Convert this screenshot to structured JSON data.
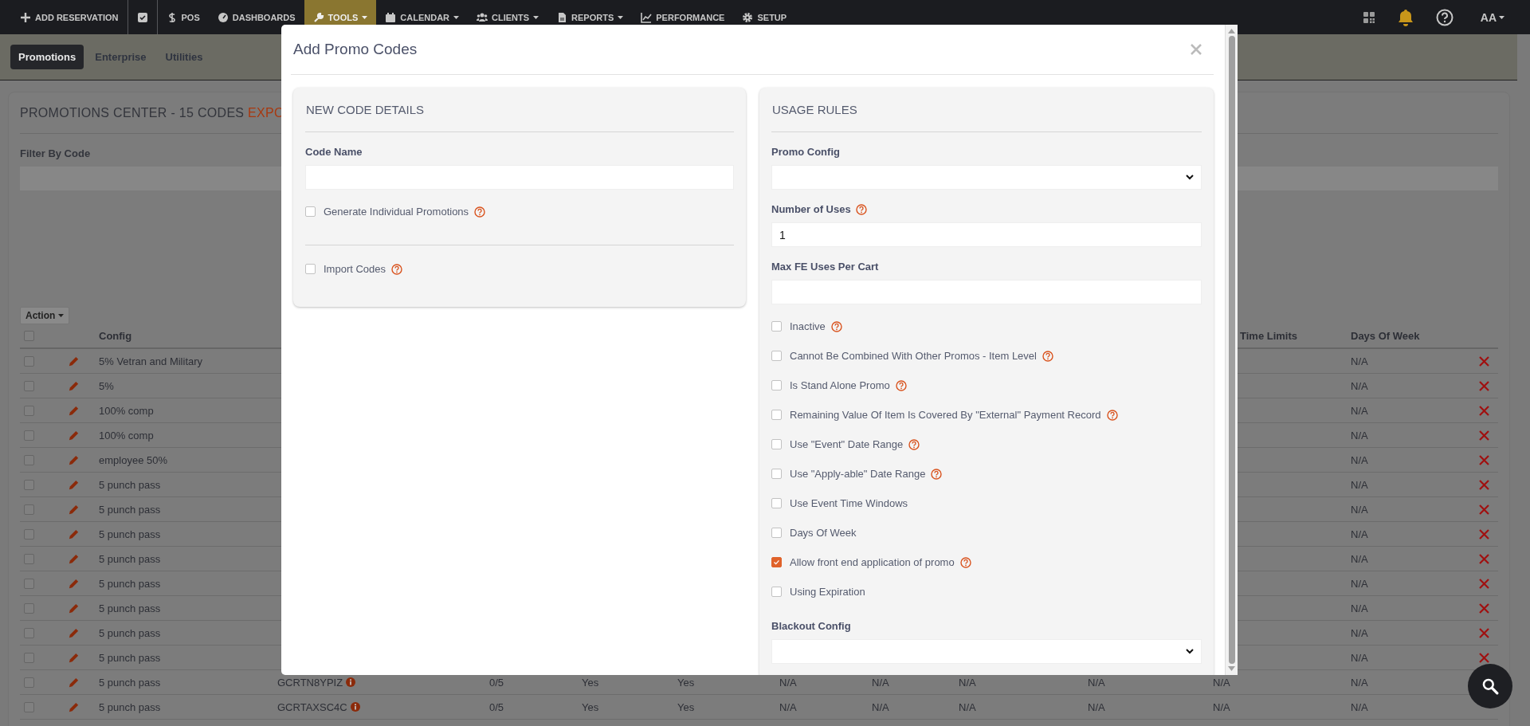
{
  "nav": {
    "items": [
      {
        "label": "ADD RESERVATION",
        "selected": false,
        "dropdown": false
      },
      {
        "selected": false,
        "dropdown": false
      },
      {
        "label": "POS",
        "selected": false,
        "dropdown": false
      },
      {
        "label": "DASHBOARDS",
        "selected": false,
        "dropdown": false
      },
      {
        "label": "TOOLS",
        "selected": true,
        "dropdown": true
      },
      {
        "label": "CALENDAR",
        "selected": false,
        "dropdown": true
      },
      {
        "label": "CLIENTS",
        "selected": false,
        "dropdown": true
      },
      {
        "label": "REPORTS",
        "selected": false,
        "dropdown": true
      },
      {
        "label": "PERFORMANCE",
        "selected": false,
        "dropdown": false
      },
      {
        "label": "SETUP",
        "selected": false,
        "dropdown": false
      }
    ],
    "account": "AA"
  },
  "subtabs": [
    {
      "label": "Promotions",
      "selected": true
    },
    {
      "label": "Enterprise",
      "selected": false
    },
    {
      "label": "Utilities",
      "selected": false
    }
  ],
  "page": {
    "title": "PROMOTIONS CENTER - 15 CODES",
    "title_link": "EXPO",
    "filter_label": "Filter By Code",
    "action_button": "Action"
  },
  "table": {
    "all_checked": false,
    "columns": {
      "config": "Config",
      "time_limits": "Time Limits",
      "days_of_week": "Days Of Week"
    },
    "rows": [
      {
        "checked": false,
        "config": "5% Vetran and Military",
        "days_of_week": "N/A",
        "delete": true
      },
      {
        "checked": false,
        "config": "5%",
        "days_of_week": "N/A",
        "delete": true
      },
      {
        "checked": false,
        "config": "100% comp",
        "days_of_week": "N/A",
        "delete": true
      },
      {
        "checked": false,
        "config": "100% comp",
        "days_of_week": "N/A",
        "delete": true
      },
      {
        "checked": false,
        "config": "employee 50%",
        "days_of_week": "N/A",
        "delete": true
      },
      {
        "checked": false,
        "config": "5 punch pass",
        "days_of_week": "N/A",
        "delete": true
      },
      {
        "checked": false,
        "config": "5 punch pass",
        "days_of_week": "N/A",
        "delete": true
      },
      {
        "checked": false,
        "config": "5 punch pass",
        "days_of_week": "N/A",
        "delete": true
      },
      {
        "checked": false,
        "config": "5 punch pass",
        "days_of_week": "N/A",
        "delete": true
      },
      {
        "checked": false,
        "config": "5 punch pass",
        "days_of_week": "N/A",
        "delete": true
      },
      {
        "checked": false,
        "config": "5 punch pass",
        "days_of_week": "N/A",
        "delete": true
      },
      {
        "checked": false,
        "config": "5 punch pass",
        "days_of_week": "N/A",
        "delete": true
      },
      {
        "checked": false,
        "config": "5 punch pass",
        "days_of_week": "N/A",
        "delete": true
      },
      {
        "checked": false,
        "config": "5 punch pass",
        "cells": [
          "GCRTN8YPIZ",
          "0/5",
          "Yes",
          "Yes",
          "N/A",
          "N/A",
          "N/A",
          "N/A",
          "N/A"
        ],
        "days_of_week": "N/A"
      },
      {
        "checked": false,
        "config": "5 punch pass",
        "cells": [
          "GCRTAXSC4C",
          "0/5",
          "Yes",
          "Yes",
          "N/A",
          "N/A",
          "N/A",
          "N/A",
          "N/A"
        ],
        "days_of_week": "N/A"
      }
    ]
  },
  "modal": {
    "title": "Add Promo Codes",
    "left_panel": {
      "title": "NEW CODE DETAILS",
      "items": [
        {
          "kind": "text",
          "label": "Code Name",
          "help": false
        },
        {
          "kind": "checkbox",
          "label": "Generate Individual Promotions",
          "checked": false,
          "help": true
        },
        {
          "kind": "divider"
        },
        {
          "kind": "checkbox",
          "label": "Import Codes",
          "checked": false,
          "help": true
        }
      ]
    },
    "right_panel": {
      "title": "USAGE RULES",
      "items": [
        {
          "kind": "select",
          "label": "Promo Config",
          "help": false
        },
        {
          "kind": "text",
          "label": "Number of Uses",
          "help": true,
          "value": "1"
        },
        {
          "kind": "text",
          "label": "Max FE Uses Per Cart",
          "help": false
        },
        {
          "kind": "checkbox",
          "label": "Inactive",
          "checked": false,
          "help": true
        },
        {
          "kind": "checkbox",
          "label": "Cannot Be Combined With Other Promos - Item Level",
          "checked": false,
          "help": true
        },
        {
          "kind": "checkbox",
          "label": "Is Stand Alone Promo",
          "checked": false,
          "help": true
        },
        {
          "kind": "checkbox",
          "label": "Remaining Value Of Item Is Covered By \"External\" Payment Record",
          "checked": false,
          "help": true
        },
        {
          "kind": "checkbox",
          "label": "Use \"Event\" Date Range",
          "checked": false,
          "help": true
        },
        {
          "kind": "checkbox",
          "label": "Use \"Apply-able\" Date Range",
          "checked": false,
          "help": true
        },
        {
          "kind": "checkbox",
          "label": "Use Event Time Windows",
          "checked": false,
          "help": false
        },
        {
          "kind": "checkbox",
          "label": "Days Of Week",
          "checked": false,
          "help": false
        },
        {
          "kind": "checkbox",
          "label": "Allow front end application of promo",
          "checked": true,
          "help": true
        },
        {
          "kind": "checkbox",
          "label": "Using Expiration",
          "checked": false,
          "help": false
        },
        {
          "kind": "select",
          "label": "Blackout Config",
          "help": false
        }
      ]
    }
  }
}
